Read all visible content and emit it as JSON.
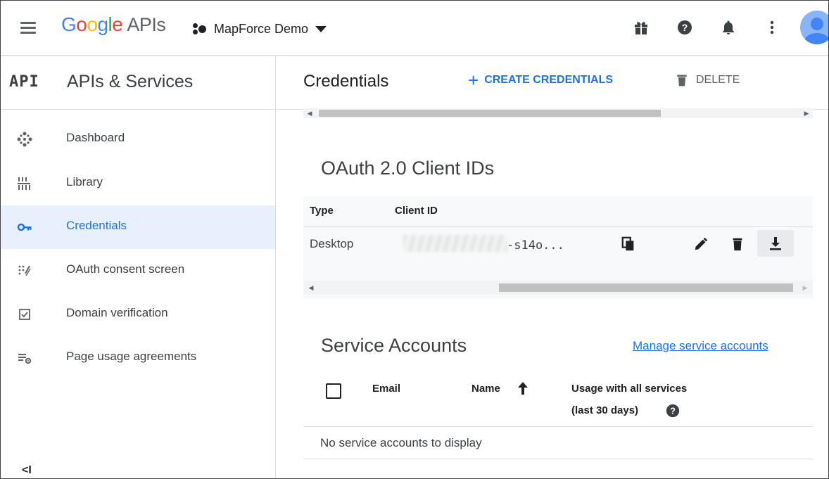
{
  "header": {
    "logo_google": [
      "G",
      "o",
      "o",
      "g",
      "l",
      "e"
    ],
    "logo_apis": "APIs",
    "project_name": "MapForce Demo"
  },
  "sidebar": {
    "badge": "API",
    "title": "APIs & Services",
    "items": [
      {
        "label": "Dashboard",
        "icon": "dashboard-icon",
        "active": false
      },
      {
        "label": "Library",
        "icon": "library-icon",
        "active": false
      },
      {
        "label": "Credentials",
        "icon": "key-icon",
        "active": true
      },
      {
        "label": "OAuth consent screen",
        "icon": "consent-icon",
        "active": false
      },
      {
        "label": "Domain verification",
        "icon": "checkbox-icon",
        "active": false
      },
      {
        "label": "Page usage agreements",
        "icon": "settings-list-icon",
        "active": false
      }
    ],
    "collapse_label": "<I"
  },
  "main": {
    "title": "Credentials",
    "create_label": "CREATE CREDENTIALS",
    "create_plus": "+",
    "delete_label": "DELETE"
  },
  "oauth": {
    "title": "OAuth 2.0 Client IDs",
    "col_type": "Type",
    "col_client_id": "Client ID",
    "row_type": "Desktop",
    "row_client_id_suffix": "-s14o..."
  },
  "service_accounts": {
    "title": "Service Accounts",
    "manage_link": "Manage service accounts",
    "col_email": "Email",
    "col_name": "Name",
    "col_usage_line1": "Usage with all services",
    "col_usage_line2": "(last 30 days)",
    "empty_text": "No service accounts to display"
  },
  "colors": {
    "accent": "#1a73e8",
    "active_bg": "#e8f0fe",
    "text": "#3c4043"
  }
}
